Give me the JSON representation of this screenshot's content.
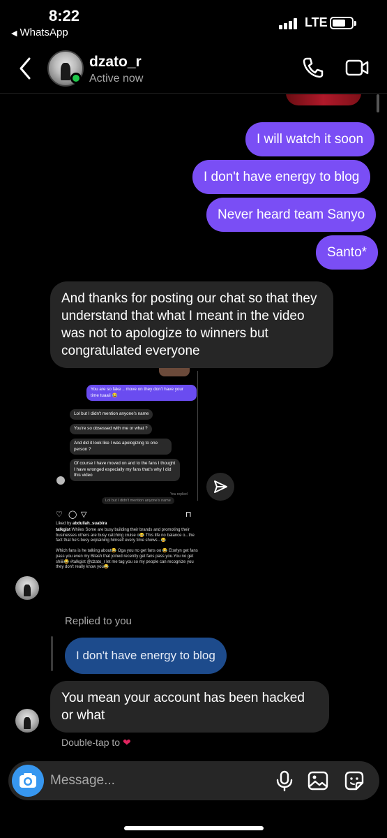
{
  "status_bar": {
    "time": "8:22",
    "back_app": "WhatsApp",
    "network": "LTE"
  },
  "header": {
    "name": "dzato_r",
    "status": "Active now",
    "icons": [
      "back-arrow",
      "phone",
      "video-camera"
    ]
  },
  "messages": {
    "sent": [
      "I will watch it soon",
      "I don't have energy to blog",
      "Never heard team Sanyo",
      "Santo*"
    ],
    "received_1": "And thanks for posting our chat so that they understand that what I meant in the video was not to apologize to winners but congratulated everyone",
    "replied_label": "Replied to you",
    "reply_quote": "I don't have energy to blog",
    "received_2": "You mean your account has been hacked or what",
    "double_tap_hint": "Double-tap to"
  },
  "shared_post": {
    "mini_sent": "You are so fake .. move on they don't have your time tuaaii 😂",
    "mini_received": [
      "Lol but I didn't mention anyone's name",
      "You're so obsessed with me or what ?",
      "And did it look like I was apologizing to one person ?",
      "Of course I have moved on and to the fans I thought I have wronged especially my fans that's why I did this video"
    ],
    "mini_replied": "You replied",
    "mini_quote": "Lol but I didn't mention anyone's name",
    "liked_by_prefix": "Liked by ",
    "liked_by_user": "abdullah_suabira",
    "caption_user": "talkgist",
    "caption": " Whiles Some are busy building their brands and promoting their businesses others are busy catching cruise o😂 This life no balance o...the fact that he's busy explaining himself every time shows...😂",
    "caption_2": "Which fans is he talking about😂 Oga you no get fans oo 😂 Etorlyn get fans pass you even my Bilash that joined recently get fans pass you.You no get shiiii😂 #talkgist @dzato_r let me tag you so my people can recognize you they don't really know you😂"
  },
  "composer": {
    "placeholder": "Message...",
    "icons": [
      "camera",
      "microphone",
      "gallery",
      "sticker"
    ]
  },
  "colors": {
    "sent_bubble": "#7a4ef5",
    "received_bubble": "#262626",
    "reply_quote": "#1d4b8c",
    "camera_button": "#3797f0",
    "online": "#1fc84a"
  }
}
